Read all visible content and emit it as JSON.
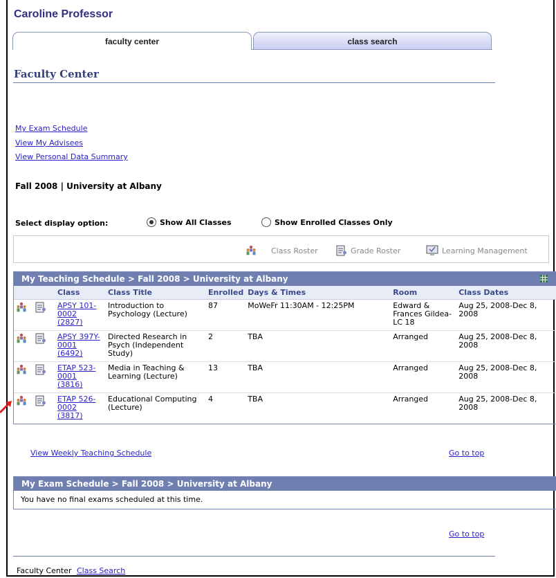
{
  "user": {
    "name": "Caroline Professor"
  },
  "tabs": [
    {
      "label": "faculty center",
      "active": true
    },
    {
      "label": "class search",
      "active": false
    }
  ],
  "page": {
    "title": "Faculty Center"
  },
  "quick_links": [
    "My Exam Schedule",
    "View My Advisees",
    "View Personal Data Summary"
  ],
  "term": "Fall 2008 | University at Albany",
  "display_option": {
    "label": "Select display option:",
    "options": [
      {
        "label": "Show All Classes",
        "selected": true
      },
      {
        "label": "Show Enrolled Classes Only",
        "selected": false
      }
    ]
  },
  "legend": {
    "class_roster": "Class Roster",
    "grade_roster": "Grade Roster",
    "learning_management": "Learning Management"
  },
  "schedule": {
    "header": "My Teaching Schedule > Fall 2008 > University at Albany",
    "columns": [
      "Class",
      "Class Title",
      "Enrolled",
      "Days & Times",
      "Room",
      "Class Dates"
    ],
    "rows": [
      {
        "class_l1": "APSY 101-",
        "class_l2": "0002",
        "class_l3": "(2827)",
        "title": "Introduction to Psychology (Lecture)",
        "enrolled": "87",
        "days": "MoWeFr 11:30AM - 12:25PM",
        "room": "Edward & Frances Gildea-LC 18",
        "dates": "Aug 25, 2008-Dec 8, 2008"
      },
      {
        "class_l1": "APSY 397Y-",
        "class_l2": "0001",
        "class_l3": "(6492)",
        "title": "Directed Research in Psych (Independent Study)",
        "enrolled": "2",
        "days": "TBA",
        "room": "Arranged",
        "dates": "Aug 25, 2008-Dec 8, 2008"
      },
      {
        "class_l1": "ETAP 523-",
        "class_l2": "0001",
        "class_l3": "(3816)",
        "title": "Media in Teaching & Learning (Lecture)",
        "enrolled": "13",
        "days": "TBA",
        "room": "Arranged",
        "dates": "Aug 25, 2008-Dec 8, 2008"
      },
      {
        "class_l1": "ETAP 526-",
        "class_l2": "0002",
        "class_l3": "(3817)",
        "title": "Educational Computing (Lecture)",
        "enrolled": "4",
        "days": "TBA",
        "room": "Arranged",
        "dates": "Aug 25, 2008-Dec 8, 2008"
      }
    ]
  },
  "links": {
    "weekly": "View Weekly Teaching Schedule",
    "go_top": "Go to top"
  },
  "exam": {
    "header": "My Exam Schedule > Fall 2008 > University at Albany",
    "message": "You have no final exams scheduled at this time."
  },
  "footer": {
    "text": "Faculty Center",
    "link": "Class Search"
  },
  "colors": {
    "grid_header": "#6f7fb0",
    "link": "#2a22c8",
    "title": "#36417a",
    "arrow": "#e02020"
  }
}
